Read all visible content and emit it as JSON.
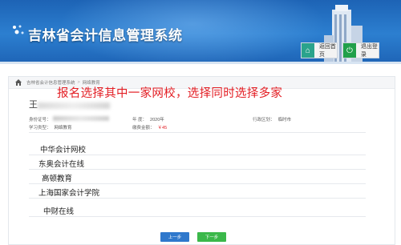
{
  "header": {
    "title": "吉林省会计信息管理系统",
    "home_label": "返回首页",
    "logout_label": "退出登录"
  },
  "breadcrumb": {
    "items": [
      "吉林省会计信息管理系统",
      "网络教育"
    ]
  },
  "annotation": "报名选择其中一家网校，选择同时选择多家",
  "student": {
    "name_first_char": "王",
    "id_label": "身份证号：",
    "study_type_label": "学习类型：",
    "study_type_value": "网络教育",
    "year_label": "年    度：",
    "year_value": "2020年",
    "fee_label": "缴费金额：",
    "fee_value": "￥45",
    "region_label": "行政区划：",
    "region_value": "临时市"
  },
  "schools": [
    "中华会计网校",
    "东奥会计在线",
    "高顿教育",
    "上海国家会计学院",
    "中财在线"
  ],
  "buttons": {
    "prev": "上一步",
    "next": "下一步"
  },
  "colors": {
    "header_blue": "#2c7fd0",
    "annotation_red": "#e31e24",
    "prev_blue": "#2f78cc",
    "next_green": "#3bb84a"
  }
}
